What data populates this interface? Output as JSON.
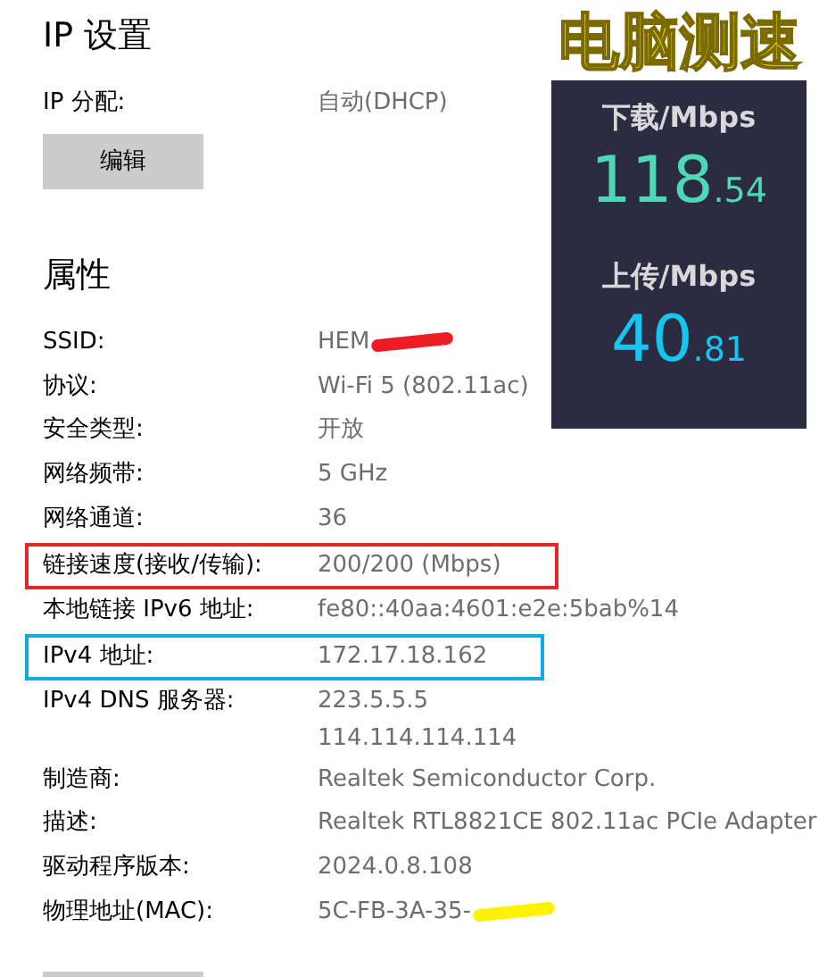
{
  "ip_settings": {
    "title": "IP 设置",
    "assignment_label": "IP 分配:",
    "assignment_value": "自动(DHCP)",
    "edit_button": "编辑"
  },
  "properties": {
    "title": "属性",
    "rows": [
      {
        "label": "SSID:",
        "values": [
          "HEM"
        ],
        "redaction": {
          "color": "#ee1c25"
        }
      },
      {
        "label": "协议:",
        "values": [
          "Wi-Fi 5 (802.11ac)"
        ]
      },
      {
        "label": "安全类型:",
        "values": [
          "开放"
        ]
      },
      {
        "label": "网络频带:",
        "values": [
          "5 GHz"
        ]
      },
      {
        "label": "网络通道:",
        "values": [
          "36"
        ]
      },
      {
        "label": "链接速度(接收/传输):",
        "values": [
          "200/200 (Mbps)"
        ],
        "highlight": {
          "color": "#e8262d"
        }
      },
      {
        "label": "本地链接 IPv6 地址:",
        "values": [
          "fe80::40aa:4601:e2e:5bab%14"
        ]
      },
      {
        "label": "IPv4 地址:",
        "values": [
          "172.17.18.162"
        ],
        "highlight": {
          "color": "#10a8e4"
        }
      },
      {
        "label": "IPv4 DNS 服务器:",
        "values": [
          "223.5.5.5",
          "114.114.114.114"
        ]
      },
      {
        "label": "制造商:",
        "values": [
          "Realtek Semiconductor Corp."
        ]
      },
      {
        "label": "描述:",
        "values": [
          "Realtek RTL8821CE 802.11ac PCIe Adapter"
        ]
      },
      {
        "label": "驱动程序版本:",
        "values": [
          "2024.0.8.108"
        ]
      },
      {
        "label": "物理地址(MAC):",
        "values": [
          "5C-FB-3A-35-"
        ],
        "redaction": {
          "color": "#fff200"
        }
      }
    ]
  },
  "speed_overlay": {
    "title": "电脑测速",
    "download_label": "下载/Mbps",
    "download_whole": "118",
    "download_fraction": ".54",
    "upload_label": "上传/Mbps",
    "upload_whole": "40",
    "upload_fraction": ".81"
  }
}
